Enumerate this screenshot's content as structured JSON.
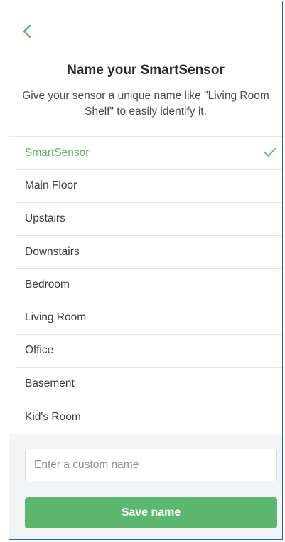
{
  "colors": {
    "accent": "#5cb86e",
    "text": "#3a3a3a",
    "divider": "#e6e6e6",
    "frame_border": "#1f5fd1"
  },
  "header": {
    "back_icon": "chevron-left-icon",
    "title": "Name your SmartSensor",
    "subtitle": "Give your sensor a unique name like \"Living Room Shelf\" to easily identify it."
  },
  "name_options": {
    "items": [
      {
        "label": "SmartSensor",
        "selected": true
      },
      {
        "label": "Main Floor",
        "selected": false
      },
      {
        "label": "Upstairs",
        "selected": false
      },
      {
        "label": "Downstairs",
        "selected": false
      },
      {
        "label": "Bedroom",
        "selected": false
      },
      {
        "label": "Living Room",
        "selected": false
      },
      {
        "label": "Office",
        "selected": false
      },
      {
        "label": "Basement",
        "selected": false
      },
      {
        "label": "Kid's Room",
        "selected": false
      }
    ],
    "selected_icon": "checkmark-icon"
  },
  "custom_name": {
    "value": "",
    "placeholder": "Enter a custom name"
  },
  "save_button": {
    "label": "Save name"
  }
}
